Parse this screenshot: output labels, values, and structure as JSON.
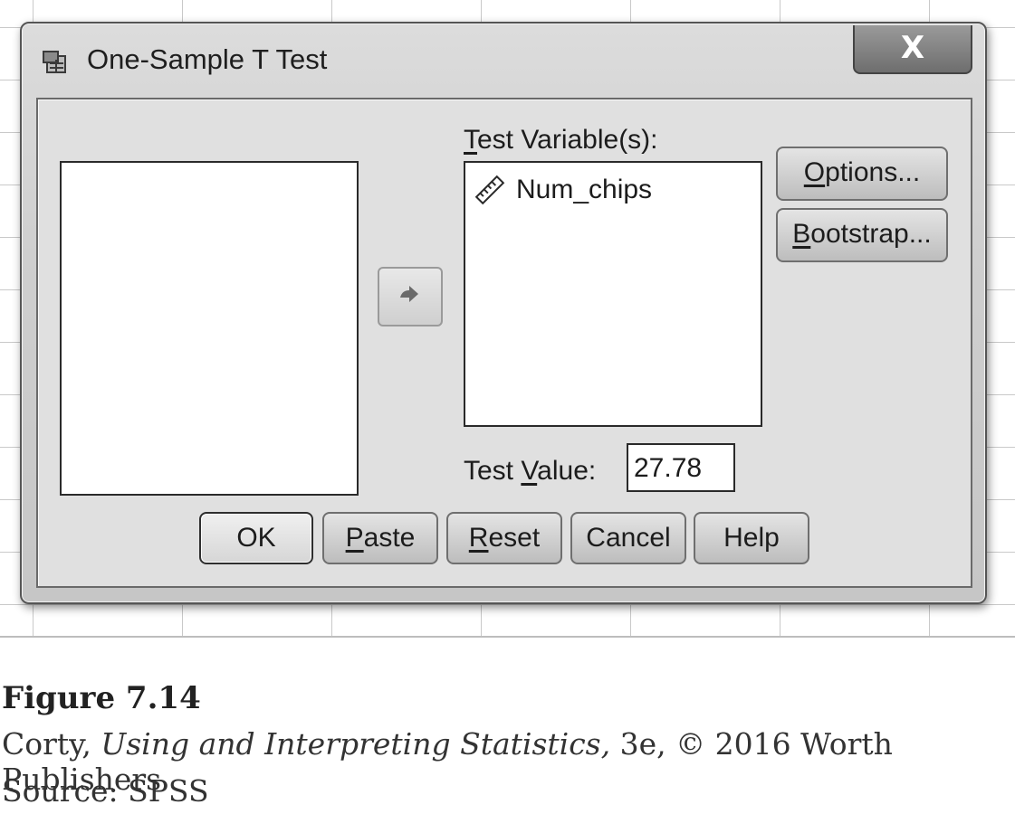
{
  "dialog": {
    "title": "One-Sample T Test",
    "close_glyph": "X",
    "test_variables_label": "Test Variable(s):",
    "test_variables": [
      {
        "name": "Num_chips",
        "icon": "scale-ruler-icon"
      }
    ],
    "options_label": "Options...",
    "bootstrap_label": "Bootstrap...",
    "test_value_label": "Test Value:",
    "test_value": "27.78",
    "buttons": {
      "ok": "OK",
      "paste": "Paste",
      "reset": "Reset",
      "cancel": "Cancel",
      "help": "Help"
    }
  },
  "caption": {
    "figure": "Figure 7.14",
    "author": "Corty,",
    "book_title": "Using and Interpreting Statistics,",
    "edition": "3e, © 2016 Worth Publishers",
    "source": "Source: SPSS"
  }
}
